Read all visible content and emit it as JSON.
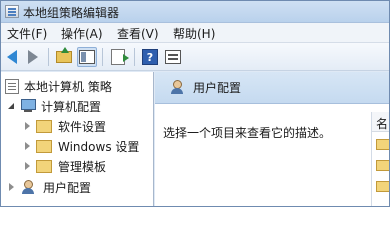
{
  "window": {
    "title": "本地组策略编辑器"
  },
  "menu": [
    {
      "label": "文件(F)"
    },
    {
      "label": "操作(A)"
    },
    {
      "label": "查看(V)"
    },
    {
      "label": "帮助(H)"
    }
  ],
  "toolbar": {
    "icons": [
      "back-icon",
      "forward-icon",
      "up-folder-icon",
      "show-hide-tree-icon",
      "export-list-icon",
      "help-icon",
      "properties-icon"
    ],
    "help_glyph": "?"
  },
  "tree": {
    "root": {
      "label": "本地计算机 策略"
    },
    "computer_config": {
      "label": "计算机配置"
    },
    "software_settings": {
      "label": "软件设置"
    },
    "windows_settings": {
      "label": "Windows 设置"
    },
    "admin_templates": {
      "label": "管理模板"
    },
    "user_config": {
      "label": "用户配置"
    }
  },
  "details": {
    "header_title": "用户配置",
    "description": "选择一个项目来查看它的描述。",
    "list_column_header": "名"
  },
  "colors": {
    "accent_blue": "#2f87d3",
    "header_bg": "#c5daf0",
    "folder": "#f2d47a"
  }
}
